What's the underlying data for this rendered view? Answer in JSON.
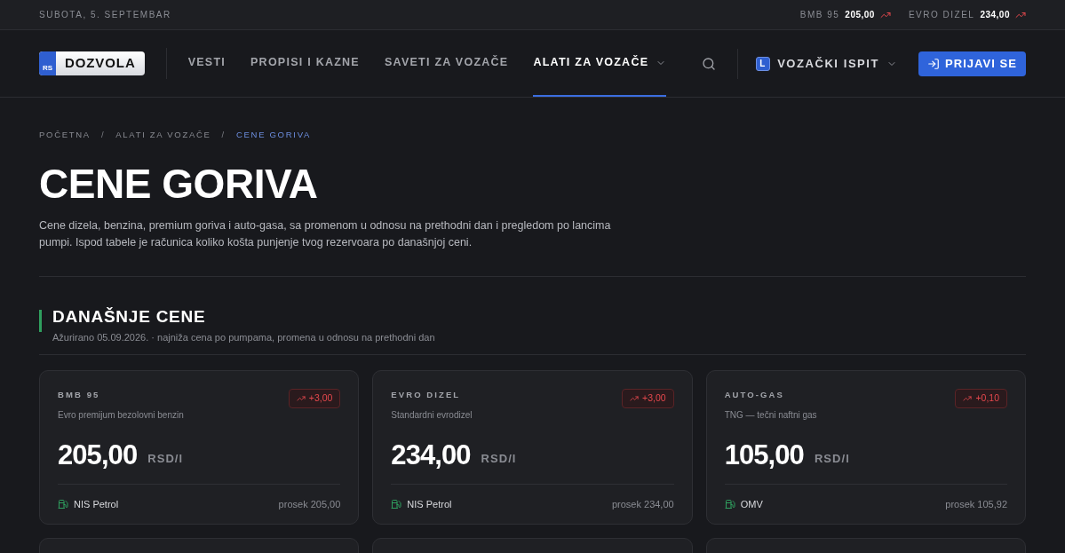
{
  "top_bar": {
    "date": "SUBOTA, 5. SEPTEMBAR",
    "tickers": [
      {
        "label": "BMB 95",
        "value": "205,00",
        "rising": true
      },
      {
        "label": "EVRO DIZEL",
        "value": "234,00",
        "rising": true
      }
    ]
  },
  "header": {
    "logo": {
      "badge": "RS",
      "text": "DOZVOLA"
    },
    "nav": [
      {
        "label": "VESTI",
        "selected": false,
        "dropdown": false
      },
      {
        "label": "PROPISI I KAZNE",
        "selected": false,
        "dropdown": false
      },
      {
        "label": "SAVETI ZA VOZAČE",
        "selected": false,
        "dropdown": false
      },
      {
        "label": "ALATI ZA VOZAČE",
        "selected": true,
        "dropdown": true
      }
    ],
    "exam": {
      "badge": "L",
      "label": "VOZAČKI ISPIT"
    },
    "login": "PRIJAVI SE"
  },
  "breadcrumbs": [
    {
      "label": "POČETNA",
      "selected": false
    },
    {
      "separator": "/",
      "label": "ALATI ZA VOZAČE",
      "selected": false
    },
    {
      "separator": "/",
      "label": "CENE GORIVA",
      "selected": true
    }
  ],
  "page": {
    "title": "CENE GORIVA",
    "intro": "Cene dizela, benzina, premium goriva i auto-gasa, sa promenom u odnosu na prethodni dan i pregledom po lancima pumpi. Ispod tabele je računica koliko košta punjenje tvog rezervoara po današnjoj ceni."
  },
  "section": {
    "title": "DANAŠNJE CENE",
    "subtitle": "Ažurirano 05.09.2026. · najniža cena po pumpama, promena u odnosu na prethodni dan"
  },
  "cards": [
    {
      "name": "BMB 95",
      "description": "Evro premijum bezolovni benzin",
      "change": "+3,00",
      "rising": true,
      "price": "205,00",
      "unit": "RSD/l",
      "station": "NIS Petrol",
      "average": "prosek 205,00"
    },
    {
      "name": "EVRO DIZEL",
      "description": "Standardni evrodizel",
      "change": "+3,00",
      "rising": true,
      "price": "234,00",
      "unit": "RSD/l",
      "station": "NIS Petrol",
      "average": "prosek 234,00"
    },
    {
      "name": "AUTO-GAS",
      "description": "TNG — tečni naftni gas",
      "change": "+0,10",
      "rising": true,
      "price": "105,00",
      "unit": "RSD/l",
      "station": "OMV",
      "average": "prosek 105,92"
    }
  ]
}
